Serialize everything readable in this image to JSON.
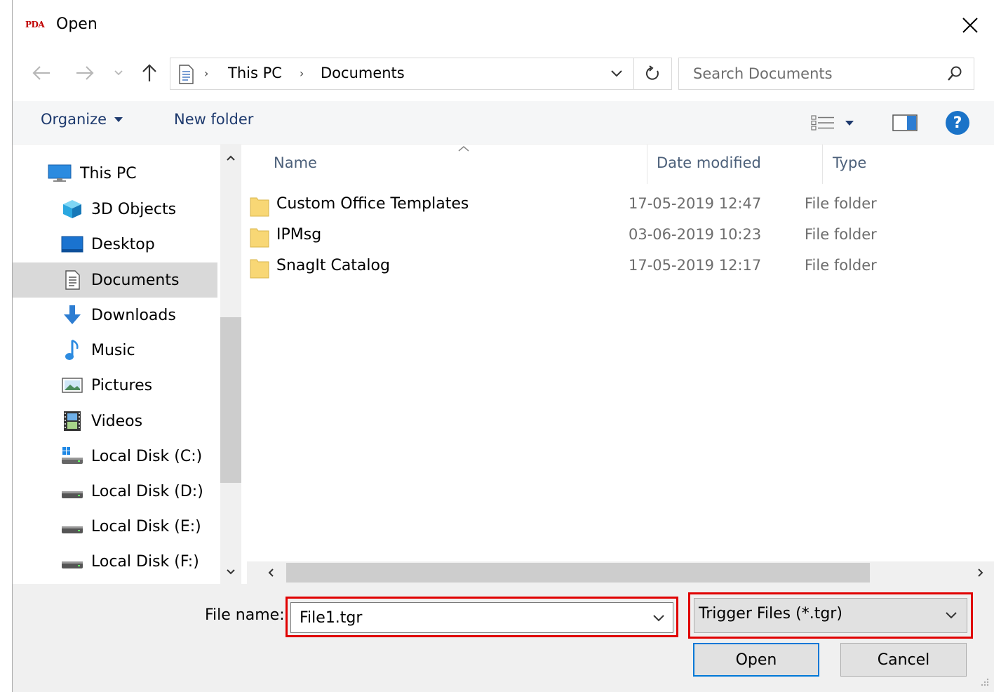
{
  "window": {
    "app_logo": "PDA",
    "title": "Open"
  },
  "address": {
    "crumbs": [
      "This PC",
      "Documents"
    ]
  },
  "search": {
    "placeholder": "Search Documents"
  },
  "toolbar": {
    "organize_label": "Organize",
    "new_folder_label": "New folder"
  },
  "nav": {
    "items": [
      {
        "label": "This PC",
        "icon": "computer-icon"
      },
      {
        "label": "3D Objects",
        "icon": "cube-icon"
      },
      {
        "label": "Desktop",
        "icon": "desktop-icon"
      },
      {
        "label": "Documents",
        "icon": "document-icon",
        "selected": true
      },
      {
        "label": "Downloads",
        "icon": "download-arrow-icon"
      },
      {
        "label": "Music",
        "icon": "music-note-icon"
      },
      {
        "label": "Pictures",
        "icon": "picture-icon"
      },
      {
        "label": "Videos",
        "icon": "film-icon"
      },
      {
        "label": "Local Disk (C:)",
        "icon": "windows-drive-icon"
      },
      {
        "label": "Local Disk (D:)",
        "icon": "drive-icon"
      },
      {
        "label": "Local Disk (E:)",
        "icon": "drive-icon"
      },
      {
        "label": "Local Disk (F:)",
        "icon": "drive-icon"
      }
    ]
  },
  "files": {
    "columns": [
      "Name",
      "Date modified",
      "Type"
    ],
    "rows": [
      {
        "name": "Custom Office Templates",
        "date": "17-05-2019 12:47",
        "type": "File folder"
      },
      {
        "name": "IPMsg",
        "date": "03-06-2019 10:23",
        "type": "File folder"
      },
      {
        "name": "SnagIt Catalog",
        "date": "17-05-2019 12:17",
        "type": "File folder"
      }
    ]
  },
  "footer": {
    "file_name_label": "File name:",
    "file_name_value": "File1.tgr",
    "file_type_value": "Trigger Files (*.tgr)",
    "open_label": "Open",
    "cancel_label": "Cancel"
  },
  "colors": {
    "accent": "#0078d7",
    "highlight": "#e00000",
    "help": "#1a73c8",
    "selected_bg": "#d9d9d9"
  }
}
